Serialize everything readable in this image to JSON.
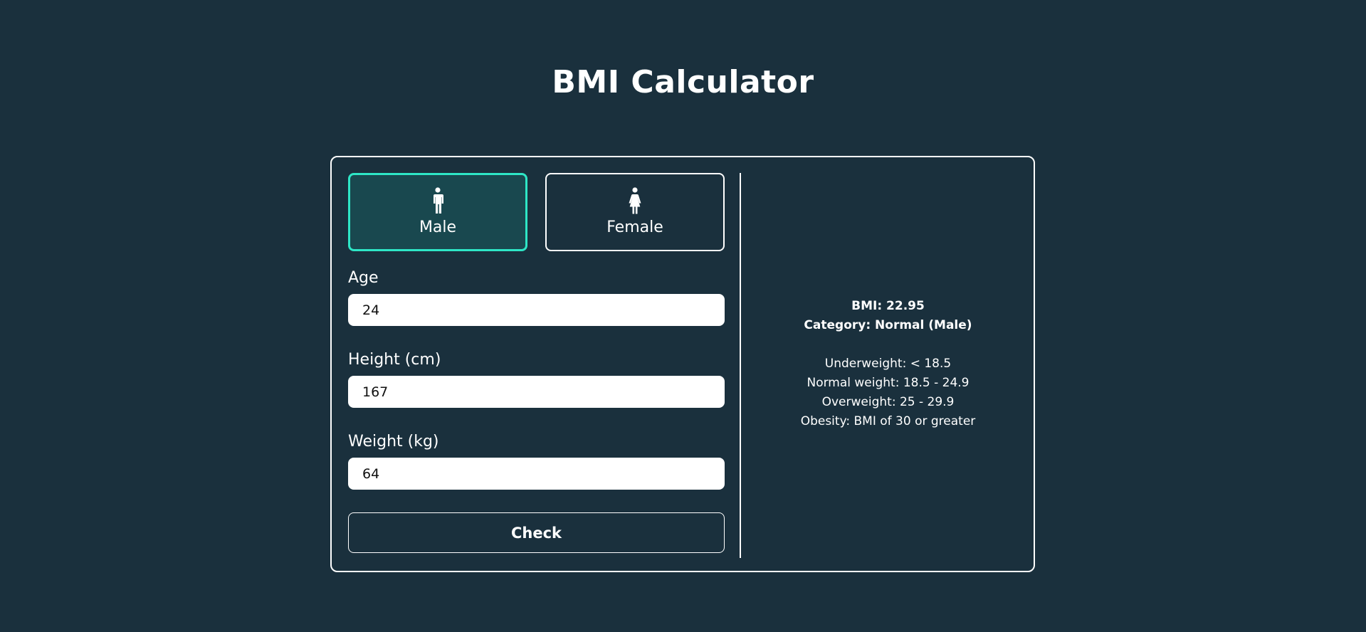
{
  "page": {
    "title": "BMI Calculator"
  },
  "gender": {
    "options": [
      {
        "label": "Male",
        "icon": "male-icon",
        "selected": true
      },
      {
        "label": "Female",
        "icon": "female-icon",
        "selected": false
      }
    ]
  },
  "form": {
    "age": {
      "label": "Age",
      "value": "24"
    },
    "height": {
      "label": "Height (cm)",
      "value": "167"
    },
    "weight": {
      "label": "Weight (kg)",
      "value": "64"
    },
    "check_label": "Check"
  },
  "result": {
    "bmi": "BMI: 22.95",
    "category": "Category: Normal (Male)",
    "ranges": [
      "Underweight: < 18.5",
      "Normal weight: 18.5 - 24.9",
      "Overweight: 25 - 29.9",
      "Obesity: BMI of 30 or greater"
    ]
  },
  "colors": {
    "background": "#1a303d",
    "accent": "#2ee6c6",
    "selected_fill": "#19484f",
    "text": "#ffffff"
  }
}
